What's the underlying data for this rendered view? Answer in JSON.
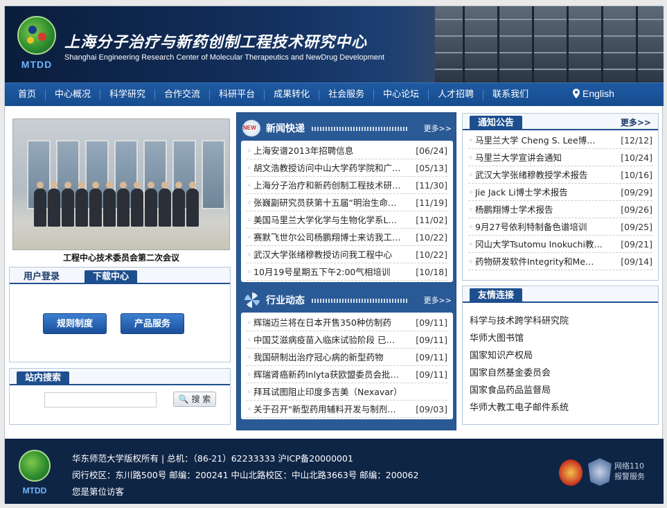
{
  "header": {
    "logo_text": "MTDD",
    "title": "上海分子治疗与新药创制工程技术研究中心",
    "subtitle": "Shanghai Engineering Research Center of Molecular Therapeutics and NewDrug Development"
  },
  "nav": {
    "items": [
      "首页",
      "中心概况",
      "科学研究",
      "合作交流",
      "科研平台",
      "成果转化",
      "社会服务",
      "中心论坛",
      "人才招聘",
      "联系我们"
    ],
    "english": "English"
  },
  "photo": {
    "caption": "工程中心技术委员会第二次会议"
  },
  "login_box": {
    "tab_login": "用户登录",
    "tab_download": "下载中心",
    "btn_rules": "规则制度",
    "btn_products": "产品服务"
  },
  "search": {
    "title": "站内搜索",
    "button": "搜 索",
    "value": ""
  },
  "news": {
    "title": "新闻快递",
    "badge": "NEW",
    "more": "更多>>",
    "items": [
      {
        "title": "上海安谱2013年招聘信息",
        "date": "[06/24]"
      },
      {
        "title": "胡文浩教授访问中山大学药学院和广…",
        "date": "[05/13]"
      },
      {
        "title": "上海分子治疗和新药创制工程技术研…",
        "date": "[11/30]"
      },
      {
        "title": "张巍副研究员获第十五届“明治生命…",
        "date": "[11/19]"
      },
      {
        "title": "美国马里兰大学化学与生物化学系L…",
        "date": "[11/02]"
      },
      {
        "title": "赛默飞世尔公司杨鹏翔博士来访我工…",
        "date": "[10/22]"
      },
      {
        "title": "武汉大学张绪穆教授访问我工程中心",
        "date": "[10/22]"
      },
      {
        "title": "10月19号星期五下午2:00气相培训",
        "date": "[10/18]"
      }
    ]
  },
  "industry": {
    "title": "行业动态",
    "more": "更多>>",
    "items": [
      {
        "title": "辉瑞迈兰将在日本开售350种仿制药",
        "date": "[09/11]"
      },
      {
        "title": "中国艾滋病疫苗入临床试验阶段 已…",
        "date": "[09/11]"
      },
      {
        "title": "我国研制出治疗冠心病的新型药物",
        "date": "[09/11]"
      },
      {
        "title": "辉瑞肾癌新药Inlyta获欧盟委员会批…",
        "date": "[09/11]"
      },
      {
        "title": "拜耳试图阻止印度多吉美（Nexavar）",
        "date": ""
      },
      {
        "title": "关于召开\"新型药用辅料开发与制剂…",
        "date": "[09/03]"
      }
    ]
  },
  "notices": {
    "title": "通知公告",
    "more": "更多>>",
    "items": [
      {
        "title": "马里兰大学 Cheng S. Lee博…",
        "date": "[12/12]"
      },
      {
        "title": "马里兰大学宣讲会通知",
        "date": "[10/24]"
      },
      {
        "title": "武汉大学张绪穆教授学术报告",
        "date": "[10/16]"
      },
      {
        "title": "Jie Jack Li博士学术报告",
        "date": "[09/29]"
      },
      {
        "title": "杨鹏翔博士学术报告",
        "date": "[09/26]"
      },
      {
        "title": "9月27号依利特制备色谱培训",
        "date": "[09/25]"
      },
      {
        "title": "冈山大学Tsutomu Inokuchi教…",
        "date": "[09/21]"
      },
      {
        "title": "药物研发软件Integrity和Me…",
        "date": "[09/14]"
      }
    ]
  },
  "links": {
    "title": "友情连接",
    "items": [
      "科学与技术跨学科研究院",
      "华师大图书馆",
      "国家知识产权局",
      "国家自然基金委员会",
      "国家食品药品监督局",
      "华师大教工电子邮件系统"
    ]
  },
  "footer": {
    "logo_text": "MTDD",
    "line1": "华东师范大学版权所有 | 总机：（86-21）62233333    沪ICP备20000001",
    "line2": "闵行校区：东川路500号    邮编：200241    中山北路校区：中山北路3663号    邮编：200062",
    "line3": "您是第位访客",
    "police_line1": "网络110",
    "police_line2": "报警服务"
  }
}
